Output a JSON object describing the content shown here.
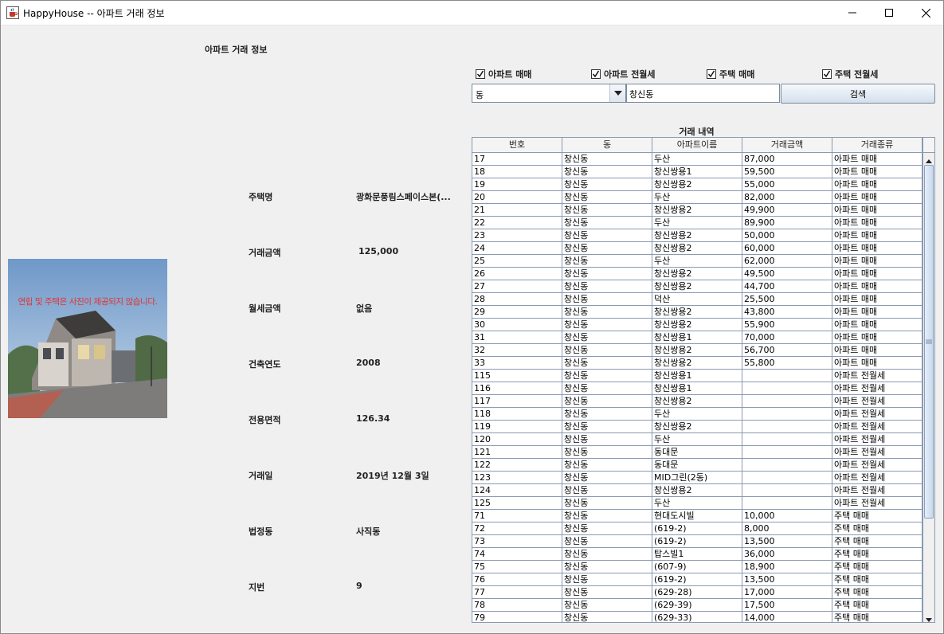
{
  "window": {
    "title": "HappyHouse -- 아파트 거래 정보"
  },
  "page": {
    "heading": "아파트 거래 정보"
  },
  "photo": {
    "caption": "연립 및 주택은 사진이 제공되지 않습니다."
  },
  "details": [
    {
      "label": "주택명",
      "value": "광화문풍림스페이스본(..."
    },
    {
      "label": "거래금액",
      "value": "125,000"
    },
    {
      "label": "월세금액",
      "value": "없음"
    },
    {
      "label": "건축연도",
      "value": "2008"
    },
    {
      "label": "전용면적",
      "value": "126.34"
    },
    {
      "label": "거래일",
      "value": "2019년 12월 3일"
    },
    {
      "label": "법정동",
      "value": "사직동"
    },
    {
      "label": "지번",
      "value": "9"
    }
  ],
  "filters": [
    {
      "label": "아파트 매매",
      "checked": true
    },
    {
      "label": "아파트 전월세",
      "checked": true
    },
    {
      "label": "주택 매매",
      "checked": true
    },
    {
      "label": "주택 전월세",
      "checked": true
    }
  ],
  "search": {
    "select_value": "동",
    "input_value": "창신동",
    "button_label": "검색"
  },
  "table": {
    "caption": "거래 내역",
    "columns": [
      "번호",
      "동",
      "아파트이름",
      "거래금액",
      "거래종류"
    ],
    "rows": [
      [
        "17",
        "창신동",
        "두산",
        "87,000",
        "아파트 매매"
      ],
      [
        "18",
        "창신동",
        "창신쌍용1",
        "59,500",
        "아파트 매매"
      ],
      [
        "19",
        "창신동",
        "창신쌍용2",
        "55,000",
        "아파트 매매"
      ],
      [
        "20",
        "창신동",
        "두산",
        "82,000",
        "아파트 매매"
      ],
      [
        "21",
        "창신동",
        "창신쌍용2",
        "49,900",
        "아파트 매매"
      ],
      [
        "22",
        "창신동",
        "두산",
        "89,900",
        "아파트 매매"
      ],
      [
        "23",
        "창신동",
        "창신쌍용2",
        "50,000",
        "아파트 매매"
      ],
      [
        "24",
        "창신동",
        "창신쌍용2",
        "60,000",
        "아파트 매매"
      ],
      [
        "25",
        "창신동",
        "두산",
        "62,000",
        "아파트 매매"
      ],
      [
        "26",
        "창신동",
        "창신쌍용2",
        "49,500",
        "아파트 매매"
      ],
      [
        "27",
        "창신동",
        "창신쌍용2",
        "44,700",
        "아파트 매매"
      ],
      [
        "28",
        "창신동",
        "덕산",
        "25,500",
        "아파트 매매"
      ],
      [
        "29",
        "창신동",
        "창신쌍용2",
        "43,800",
        "아파트 매매"
      ],
      [
        "30",
        "창신동",
        "창신쌍용2",
        "55,900",
        "아파트 매매"
      ],
      [
        "31",
        "창신동",
        "창신쌍용1",
        "70,000",
        "아파트 매매"
      ],
      [
        "32",
        "창신동",
        "창신쌍용2",
        "56,700",
        "아파트 매매"
      ],
      [
        "33",
        "창신동",
        "창신쌍용2",
        "55,800",
        "아파트 매매"
      ],
      [
        "115",
        "창신동",
        "창신쌍용1",
        "",
        "아파트 전월세"
      ],
      [
        "116",
        "창신동",
        "창신쌍용1",
        "",
        "아파트 전월세"
      ],
      [
        "117",
        "창신동",
        "창신쌍용2",
        "",
        "아파트 전월세"
      ],
      [
        "118",
        "창신동",
        "두산",
        "",
        "아파트 전월세"
      ],
      [
        "119",
        "창신동",
        "창신쌍용2",
        "",
        "아파트 전월세"
      ],
      [
        "120",
        "창신동",
        "두산",
        "",
        "아파트 전월세"
      ],
      [
        "121",
        "창신동",
        "동대문",
        "",
        "아파트 전월세"
      ],
      [
        "122",
        "창신동",
        "동대문",
        "",
        "아파트 전월세"
      ],
      [
        "123",
        "창신동",
        "MID그린(2동)",
        "",
        "아파트 전월세"
      ],
      [
        "124",
        "창신동",
        "창신쌍용2",
        "",
        "아파트 전월세"
      ],
      [
        "125",
        "창신동",
        "두산",
        "",
        "아파트 전월세"
      ],
      [
        "71",
        "창신동",
        "현대도시빌",
        "10,000",
        "주택 매매"
      ],
      [
        "72",
        "창신동",
        "(619-2)",
        "8,000",
        "주택 매매"
      ],
      [
        "73",
        "창신동",
        "(619-2)",
        "13,500",
        "주택 매매"
      ],
      [
        "74",
        "창신동",
        "탑스빌1",
        "36,000",
        "주택 매매"
      ],
      [
        "75",
        "창신동",
        "(607-9)",
        "18,900",
        "주택 매매"
      ],
      [
        "76",
        "창신동",
        "(619-2)",
        "13,500",
        "주택 매매"
      ],
      [
        "77",
        "창신동",
        "(629-28)",
        "17,000",
        "주택 매매"
      ],
      [
        "78",
        "창신동",
        "(629-39)",
        "17,500",
        "주택 매매"
      ],
      [
        "79",
        "창신동",
        "(629-33)",
        "14,000",
        "주택 매매"
      ]
    ]
  },
  "icons": {
    "app": "java-coffee-cup-icon",
    "minimize": "minimize-icon",
    "maximize": "maximize-icon",
    "close": "close-icon",
    "dropdown": "chevron-down-icon",
    "checkbox": "checkmark-icon"
  }
}
